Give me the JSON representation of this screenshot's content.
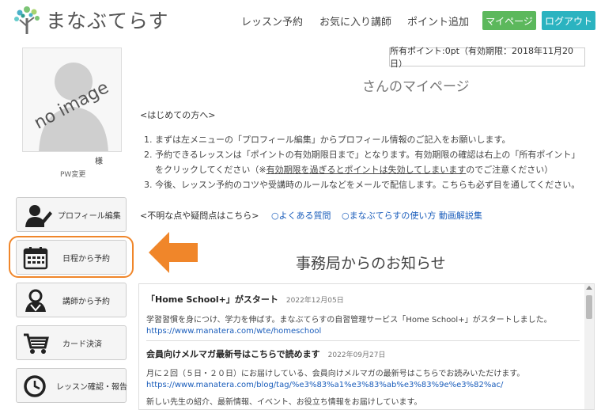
{
  "header": {
    "logo_text": "まなぶてらす",
    "nav": [
      "レッスン予約",
      "お気に入り講師",
      "ポイント追加"
    ],
    "mypage_label": "マイページ",
    "logout_label": "ログアウト",
    "colors": {
      "mypage": "#5cb85c",
      "logout": "#2bb3c0"
    }
  },
  "profile": {
    "noimage_text": "no image",
    "honorific": "様",
    "pw_change": "PW変更"
  },
  "sidebar": {
    "items": [
      {
        "label": "プロフィール編集",
        "icon": "user-edit-icon"
      },
      {
        "label": "日程から予約",
        "icon": "calendar-icon"
      },
      {
        "label": "講師から予約",
        "icon": "teacher-icon"
      },
      {
        "label": "カード決済",
        "icon": "cart-icon"
      },
      {
        "label": "レッスン確認・報告",
        "icon": "clock-icon"
      }
    ],
    "highlight_color": "#f0862a"
  },
  "main": {
    "points": "所有ポイント:0pt（有効期限：2018年11月20日）",
    "mypage_title": "さんのマイページ",
    "first_time_heading": "<はじめての方へ>",
    "instructions": [
      "1. まずは左メニューの「プロフィール編集」からプロフィール情報のご記入をお願いします。",
      "2. 予約できるレッスンは「ポイントの有効期限日まで」となります。有効期限の確認は右上の「所有ポイント」",
      "をクリックしてください（※",
      "有効期限を過ぎるとポイントは失効してしまいます",
      "のでご注意ください）",
      "3. 今後、レッスン予約のコツや受講時のルールなどをメールで配信します。こちらも必ず目を通してください。"
    ],
    "questions_heading": "<不明な点や疑問点はこちら>",
    "faq_link": "○よくある質問",
    "guide_link": "○まなぶてらすの使い方 動画解説集",
    "news_title": "事務局からのお知らせ",
    "news": [
      {
        "title": "「Home School+」がスタート",
        "date": "2022年12月05日",
        "body": "学習習慣を身につけ、学力を伸ばす。まなぶてらすの自習管理サービス「Home School+」がスタートしました。",
        "url": "https://www.manatera.com/wte/homeschool"
      },
      {
        "title": "会員向けメルマガ最新号はこちらで読めます",
        "date": "2022年09月27日",
        "body": "月に２回（５日・２０日）にお届けしている、会員向けメルマガの最新号はこちらでお読みいただけます。",
        "url": "https://www.manatera.com/blog/tag/%e3%83%a1%e3%83%ab%e3%83%9e%e3%82%ac/",
        "body2": "新しい先生の紹介、最新情報、イベント、お役立ち情報をお届けしています。"
      }
    ]
  }
}
